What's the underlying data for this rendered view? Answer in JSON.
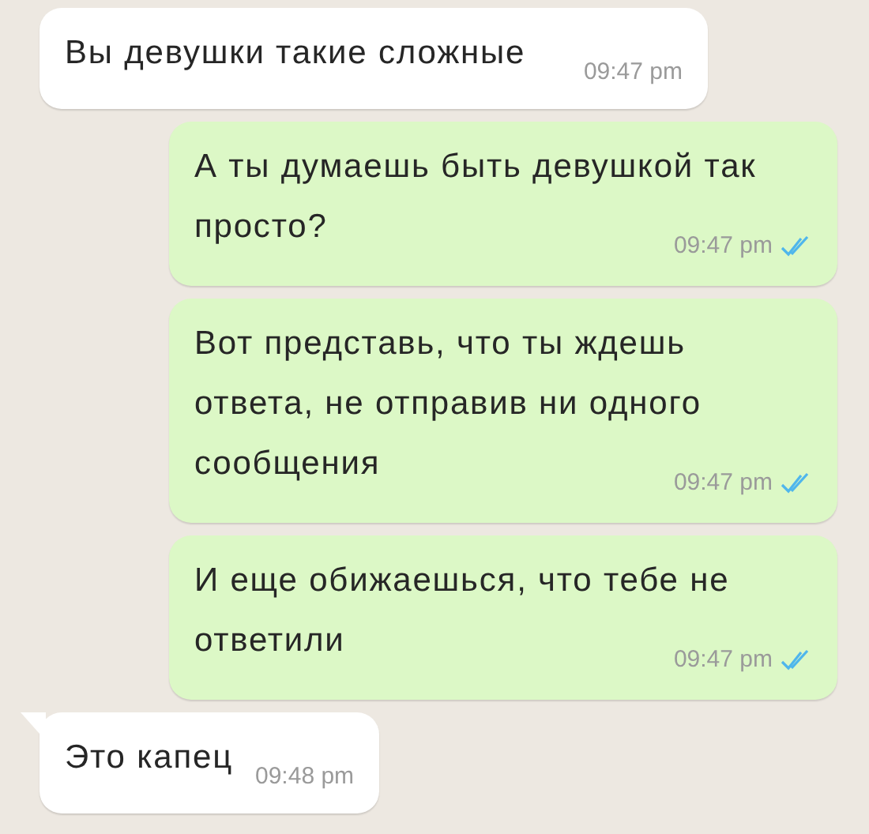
{
  "messages": [
    {
      "outgoing": false,
      "text": "Вы девушки такие сложные",
      "time": "09:47 pm",
      "tail": false
    },
    {
      "outgoing": true,
      "text": "А ты думаешь быть девушкой так просто?",
      "time": "09:47 pm",
      "read": true
    },
    {
      "outgoing": true,
      "text": "Вот представь, что ты ждешь ответа, не отправив ни одного сообщения",
      "time": "09:47 pm",
      "read": true
    },
    {
      "outgoing": true,
      "text": "И еще обижаешься, что тебе не ответили",
      "time": "09:47 pm",
      "read": true
    },
    {
      "outgoing": false,
      "text": "Это капец",
      "time": "09:48 pm",
      "tail": true
    }
  ]
}
